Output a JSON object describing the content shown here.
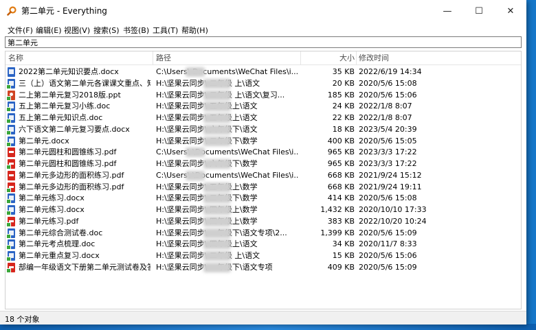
{
  "window": {
    "title": "第二单元 - Everything",
    "minimize_glyph": "—",
    "maximize_glyph": "☐",
    "close_glyph": "✕",
    "app_icon": "magnifier-icon"
  },
  "menu": [
    "文件(F)",
    "编辑(E)",
    "视图(V)",
    "搜索(S)",
    "书签(B)",
    "工具(T)",
    "帮助(H)"
  ],
  "search": {
    "value": "第二单元"
  },
  "columns": {
    "name": "名称",
    "path": "路径",
    "size": "大小",
    "date": "修改时间"
  },
  "rows": [
    {
      "icon": "docx-icon",
      "name": "2022第二单元知识要点.docx",
      "path": "C:\\Users\\     Documents\\WeChat Files\\i...",
      "size": "35 KB",
      "date": "2022/6/19 14:34"
    },
    {
      "icon": "docx-icon",
      "name": "三（上）语文第二单元各课课文重点、知...",
      "path": "H:\\坚果云同步\\        二年级 上\\语文",
      "size": "20 KB",
      "date": "2020/5/6 15:08"
    },
    {
      "icon": "ppt-icon",
      "name": "二上第二单元复习2018版.ppt",
      "path": "H:\\坚果云同步\\        二年级 上\\语文\\复习...",
      "size": "185 KB",
      "date": "2020/5/6 15:06"
    },
    {
      "icon": "docx-icon",
      "name": "五上第二单元复习小练.doc",
      "path": "H:\\坚果云同步\\        五年级上\\语文",
      "size": "24 KB",
      "date": "2022/1/8 8:07"
    },
    {
      "icon": "docx-icon",
      "name": "五上第二单元知识点.doc",
      "path": "H:\\坚果云同步\\        五年级上\\语文",
      "size": "22 KB",
      "date": "2022/1/8 8:07"
    },
    {
      "icon": "docx-icon",
      "name": "六下语文第二单元复习要点.docx",
      "path": "H:\\坚果云同步\\        六年级下\\语文",
      "size": "18 KB",
      "date": "2023/5/4 20:39"
    },
    {
      "icon": "docx-icon",
      "name": "第二单元.docx",
      "path": "H:\\坚果云同步\\        二年级下\\数学",
      "size": "400 KB",
      "date": "2020/5/6 15:05"
    },
    {
      "icon": "pdf-icon",
      "name": "第二单元圆柱和圆锥练习.pdf",
      "path": "C:\\Users\\     \\Documents\\WeChat Files\\i...",
      "size": "965 KB",
      "date": "2023/3/3 17:22"
    },
    {
      "icon": "pdf-icon",
      "name": "第二单元圆柱和圆锥练习.pdf",
      "path": "H:\\坚果云同步\\        六年级下\\数学",
      "size": "965 KB",
      "date": "2023/3/3 17:22"
    },
    {
      "icon": "pdf-icon",
      "name": "第二单元多边形的面积练习.pdf",
      "path": "C:\\Users\\     \\Documents\\WeChat Files\\i...",
      "size": "668 KB",
      "date": "2021/9/24 15:12"
    },
    {
      "icon": "pdf-icon",
      "name": "第二单元多边形的面积练习.pdf",
      "path": "H:\\坚果云同步\\        五年级上\\数学",
      "size": "668 KB",
      "date": "2021/9/24 19:11"
    },
    {
      "icon": "docx-icon",
      "name": "第二单元练习.docx",
      "path": "H:\\坚果云同步\\        二年级下\\数学",
      "size": "414 KB",
      "date": "2020/5/6 15:08"
    },
    {
      "icon": "docx-icon",
      "name": "第二单元练习.docx",
      "path": "H:\\坚果云同步\\        四年级上\\数学",
      "size": "1,432 KB",
      "date": "2020/10/10 17:33"
    },
    {
      "icon": "pdf-icon",
      "name": "第二单元练习.pdf",
      "path": "H:\\坚果云同步\\        四年级上\\数学",
      "size": "383 KB",
      "date": "2022/10/20 10:24"
    },
    {
      "icon": "docx-icon",
      "name": "第二单元综合测试卷.doc",
      "path": "H:\\坚果云同步\\        一年级下\\语文专项\\2...",
      "size": "1,399 KB",
      "date": "2020/5/6 15:09"
    },
    {
      "icon": "docx-icon",
      "name": "第二单元考点梳理.doc",
      "path": "H:\\坚果云同步\\        四年级上\\语文",
      "size": "34 KB",
      "date": "2020/11/7 8:33"
    },
    {
      "icon": "docx-icon",
      "name": "第二单元重点复习.docx",
      "path": "H:\\坚果云同步\\        二年级 上\\语文",
      "size": "15 KB",
      "date": "2020/5/6 15:06"
    },
    {
      "icon": "pdf-icon",
      "name": "部编一年级语文下册第二单元测试卷及答...",
      "path": "H:\\坚果云同步\\        一年级下\\语文专项",
      "size": "409 KB",
      "date": "2020/5/6 15:09"
    }
  ],
  "status": {
    "text": "18 个对象"
  }
}
